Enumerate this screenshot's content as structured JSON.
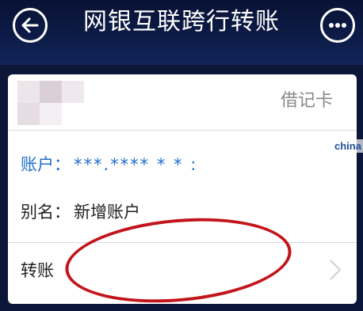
{
  "header": {
    "title": "网银互联跨行转账",
    "back_icon": "back-arrow-icon",
    "more_icon": "more-dots-icon"
  },
  "card": {
    "type_label": "借记卡",
    "account_label": "账户：",
    "account_value": "***.**** * * :",
    "alias_label": "别名：",
    "alias_value": "新增账户",
    "transfer_label": "转账",
    "masked_logo": "pixelated-bank-logo"
  },
  "watermark": "china",
  "colors": {
    "header_bg": "#0d1c48",
    "link_blue": "#1f6fc9",
    "annotation_red": "#c2151b"
  }
}
